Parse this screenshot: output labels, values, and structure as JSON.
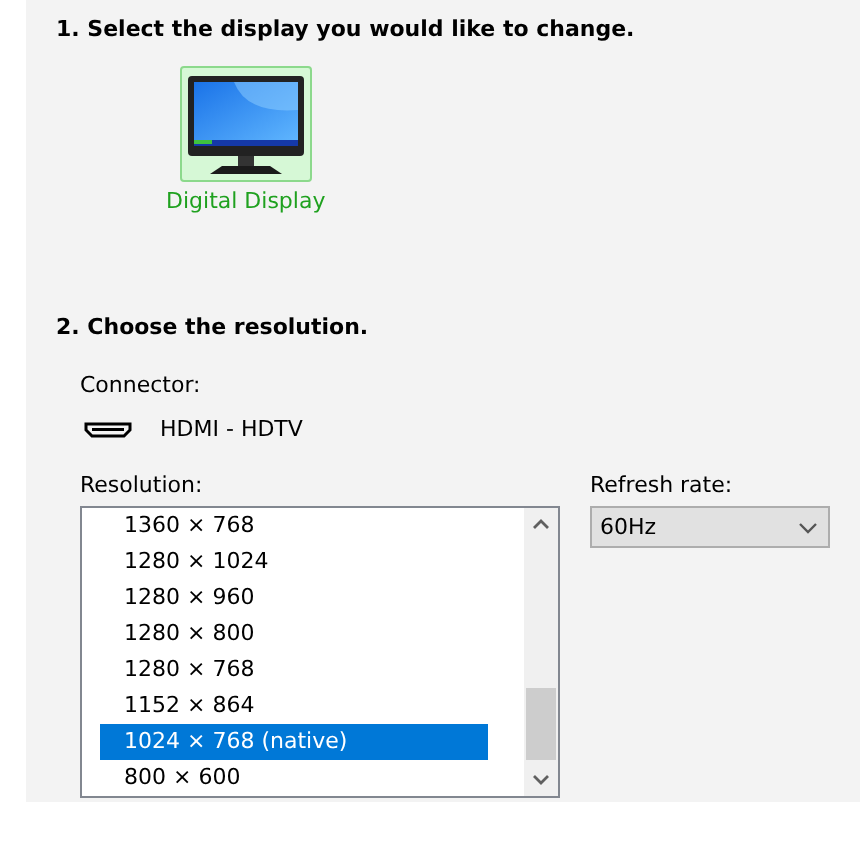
{
  "step1": {
    "heading": "1. Select the display you would like to change.",
    "displays": [
      {
        "label": "Digital Display",
        "selected": true
      }
    ]
  },
  "step2": {
    "heading": "2. Choose the resolution.",
    "connector": {
      "label": "Connector:",
      "value": "HDMI - HDTV"
    },
    "resolution": {
      "label": "Resolution:",
      "items": [
        {
          "text": "1360 × 768",
          "selected": false
        },
        {
          "text": "1280 × 1024",
          "selected": false
        },
        {
          "text": "1280 × 960",
          "selected": false
        },
        {
          "text": "1280 × 800",
          "selected": false
        },
        {
          "text": "1280 × 768",
          "selected": false
        },
        {
          "text": "1152 × 864",
          "selected": false
        },
        {
          "text": "1024 × 768 (native)",
          "selected": true
        },
        {
          "text": "800 × 600",
          "selected": false
        }
      ]
    },
    "refresh_rate": {
      "label": "Refresh rate:",
      "value": "60Hz"
    }
  }
}
